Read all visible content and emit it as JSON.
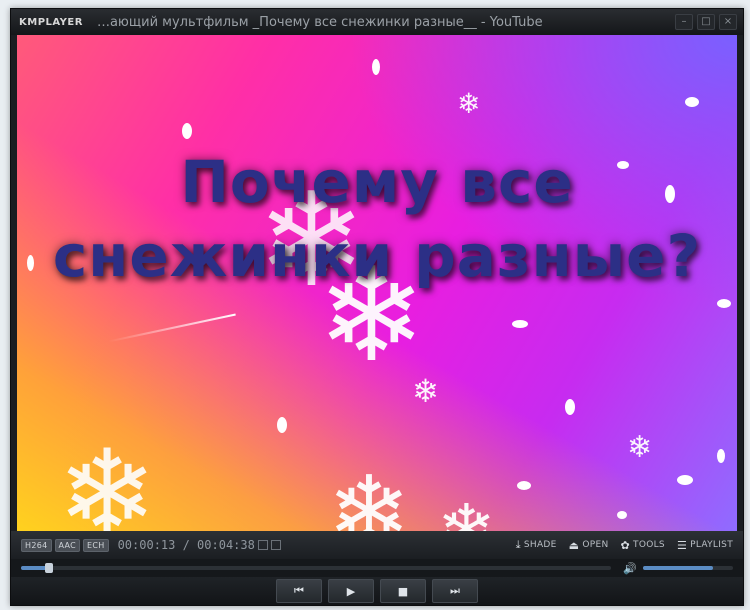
{
  "app": {
    "logo": "KMPLAYER",
    "title": "…ающий мультфильм _Почему все снежинки разные__ - YouTube"
  },
  "window_buttons": [
    {
      "name": "minimize",
      "glyph": "–"
    },
    {
      "name": "maximize",
      "glyph": "□"
    },
    {
      "name": "close",
      "glyph": "×"
    }
  ],
  "video": {
    "headline_line1": "Почему все",
    "headline_line2": "снежинки разные?"
  },
  "controlbar": {
    "badges": [
      "H264",
      "AAC",
      "ECH"
    ],
    "timecode": "00:00:13 / 00:04:38",
    "buttons": {
      "shade": {
        "icon": "⤓",
        "label": "SHADE"
      },
      "open": {
        "icon": "⏏",
        "label": "OPEN"
      },
      "tools": {
        "icon": "✿",
        "label": "TOOLS"
      },
      "playlist": {
        "icon": "☰",
        "label": "PLAYLIST"
      }
    }
  },
  "seek": {
    "progress": 0.047
  },
  "volume": {
    "icon": "🔊",
    "level": 0.78
  },
  "transport": {
    "prev": "⏮",
    "play": "▶",
    "stop": "■",
    "next": "⏭"
  },
  "colors": {
    "accent": "#5b8cc4",
    "headline": "#2c2f86"
  }
}
